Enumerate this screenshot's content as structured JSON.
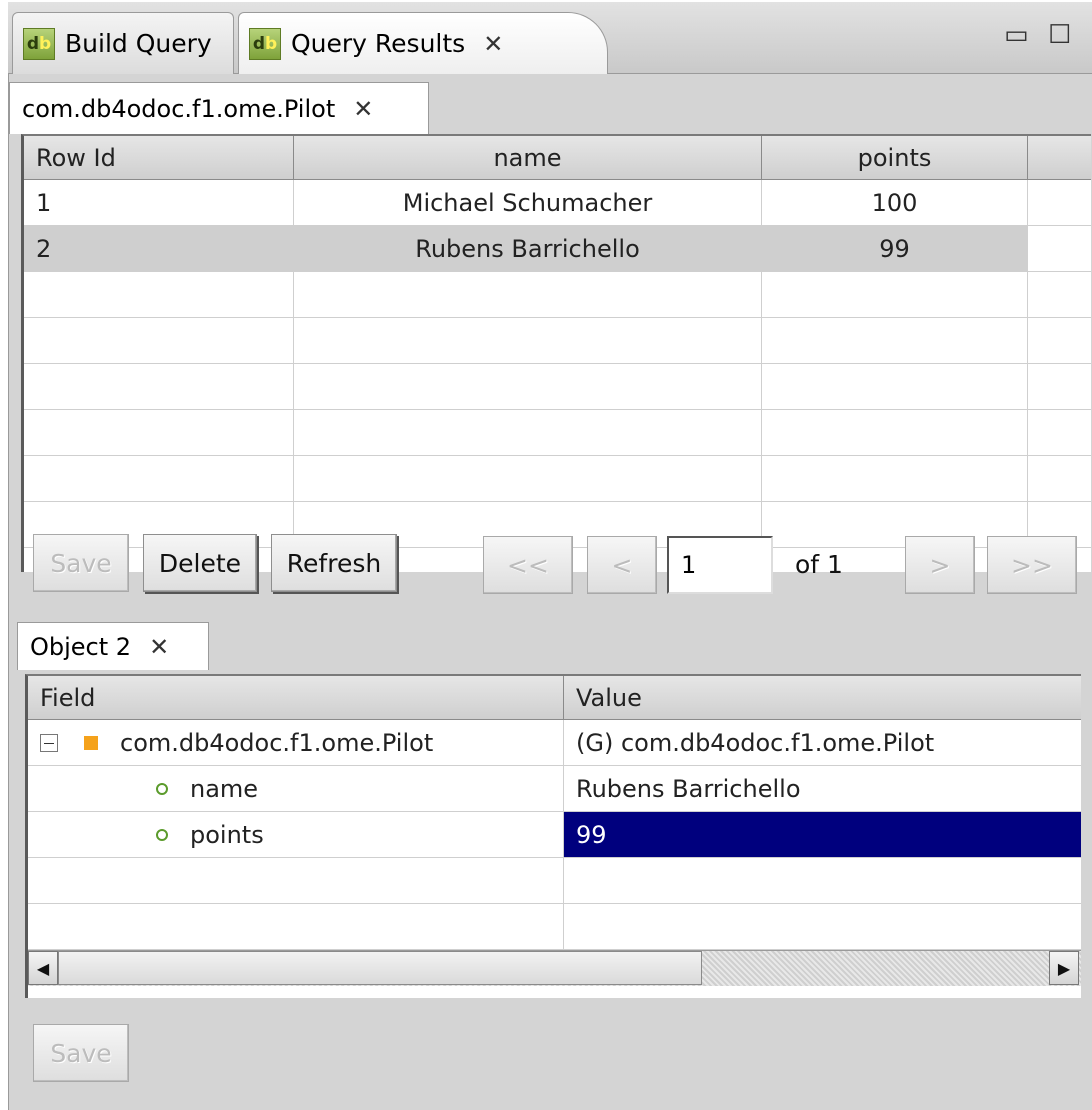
{
  "view_tabs": [
    {
      "label": "Build Query",
      "icon": "db-icon"
    },
    {
      "label": "Query Results",
      "icon": "db-icon",
      "close": "close-icon"
    }
  ],
  "results_tab": {
    "label": "com.db4odoc.f1.ome.Pilot"
  },
  "results_table": {
    "columns": [
      "Row Id",
      "name",
      "points"
    ],
    "rows": [
      {
        "id": "1",
        "name": "Michael Schumacher",
        "points": "100"
      },
      {
        "id": "2",
        "name": "Rubens Barrichello",
        "points": "99"
      }
    ]
  },
  "toolbar": {
    "save": "Save",
    "delete": "Delete",
    "refresh": "Refresh",
    "first": "<<",
    "prev": "<",
    "page_value": "1",
    "of_label": "of 1",
    "next": ">",
    "last": ">>"
  },
  "object_tab": {
    "label": "Object 2"
  },
  "property_table": {
    "columns": [
      "Field",
      "Value"
    ],
    "rows": [
      {
        "field": "com.db4odoc.f1.ome.Pilot",
        "value": "(G) com.db4odoc.f1.ome.Pilot"
      },
      {
        "field": "name",
        "value": "Rubens Barrichello"
      },
      {
        "field": "points",
        "value": "99"
      }
    ]
  },
  "bottom": {
    "save": "Save"
  },
  "colors": {
    "selection": "#00007e",
    "icon_orange": "#f5a21b",
    "icon_green": "#5b9b2c"
  }
}
